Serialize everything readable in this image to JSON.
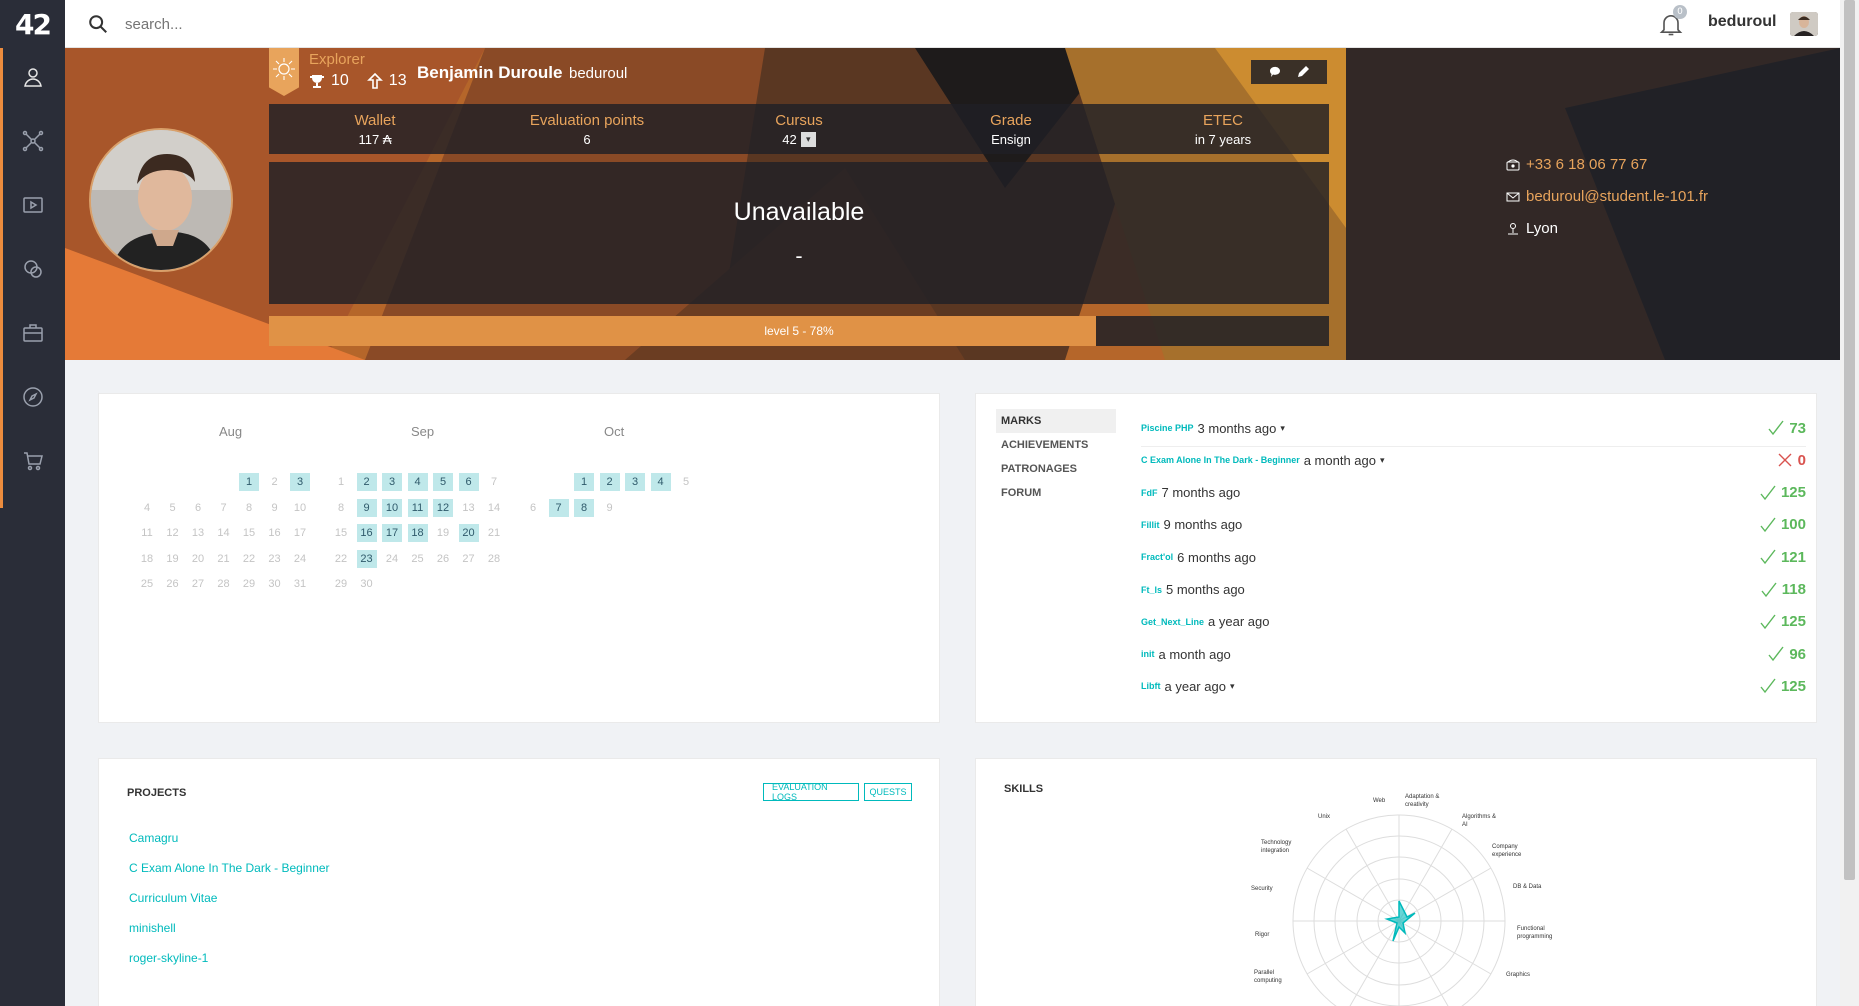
{
  "app": {
    "logo": "42"
  },
  "topbar": {
    "search_placeholder": "search...",
    "notification_count": "0",
    "login": "beduroul"
  },
  "profile": {
    "coalition": "Explorer",
    "achievements_count": "10",
    "rank_count": "13",
    "full_name": "Benjamin Duroule",
    "login": "beduroul",
    "stats": [
      {
        "label": "Wallet",
        "value": "117 ₳"
      },
      {
        "label": "Evaluation points",
        "value": "6"
      },
      {
        "label": "Cursus",
        "value": "42"
      },
      {
        "label": "Grade",
        "value": "Ensign"
      },
      {
        "label": "ETEC",
        "value": "in 7 years"
      }
    ],
    "location": "Unavailable",
    "location_sub": "-",
    "level_text": "level 5 - 78%",
    "level_progress": 0.78,
    "phone": "+33 6 18 06 77 67",
    "email": "beduroul@student.le-101.fr",
    "city": "Lyon"
  },
  "calendar": {
    "months": [
      "Aug",
      "Sep",
      "Oct"
    ]
  },
  "marks": {
    "tabs": [
      "MARKS",
      "ACHIEVEMENTS",
      "PATRONAGES",
      "FORUM"
    ],
    "items": [
      {
        "name": "Piscine PHP",
        "date": "3 months ago",
        "caret": true,
        "score": "73",
        "passed": true
      },
      {
        "name": "C Exam Alone In The Dark - Beginner",
        "date": "a month ago",
        "caret": true,
        "score": "0",
        "passed": false
      },
      {
        "name": "FdF",
        "date": "7 months ago",
        "caret": false,
        "score": "125",
        "passed": true
      },
      {
        "name": "Fillit",
        "date": "9 months ago",
        "caret": false,
        "score": "100",
        "passed": true
      },
      {
        "name": "Fract'ol",
        "date": "6 months ago",
        "caret": false,
        "score": "121",
        "passed": true
      },
      {
        "name": "Ft_ls",
        "date": "5 months ago",
        "caret": false,
        "score": "118",
        "passed": true
      },
      {
        "name": "Get_Next_Line",
        "date": "a year ago",
        "caret": false,
        "score": "125",
        "passed": true
      },
      {
        "name": "init",
        "date": "a month ago",
        "caret": false,
        "score": "96",
        "passed": true
      },
      {
        "name": "Libft",
        "date": "a year ago",
        "caret": true,
        "score": "125",
        "passed": true
      }
    ]
  },
  "projects": {
    "title": "PROJECTS",
    "btn_logs": "EVALUATION LOGS",
    "btn_quests": "QUESTS",
    "items": [
      "Camagru",
      "C Exam Alone In The Dark - Beginner",
      "Curriculum Vitae",
      "minishell",
      "roger-skyline-1"
    ]
  },
  "skills": {
    "title": "SKILLS",
    "labels": [
      "Web",
      "Adaptation & creativity",
      "Algorithms & AI",
      "Company experience",
      "DB & Data",
      "Functional programming",
      "Graphics",
      "Parallel computing",
      "Rigor",
      "Security",
      "Technology integration",
      "Unix"
    ]
  },
  "colors": {
    "accent": "#00babc",
    "orange": "#e8a45c",
    "sidebar": "#2a2d38",
    "success": "#5cb85c",
    "fail": "#d9534f"
  }
}
